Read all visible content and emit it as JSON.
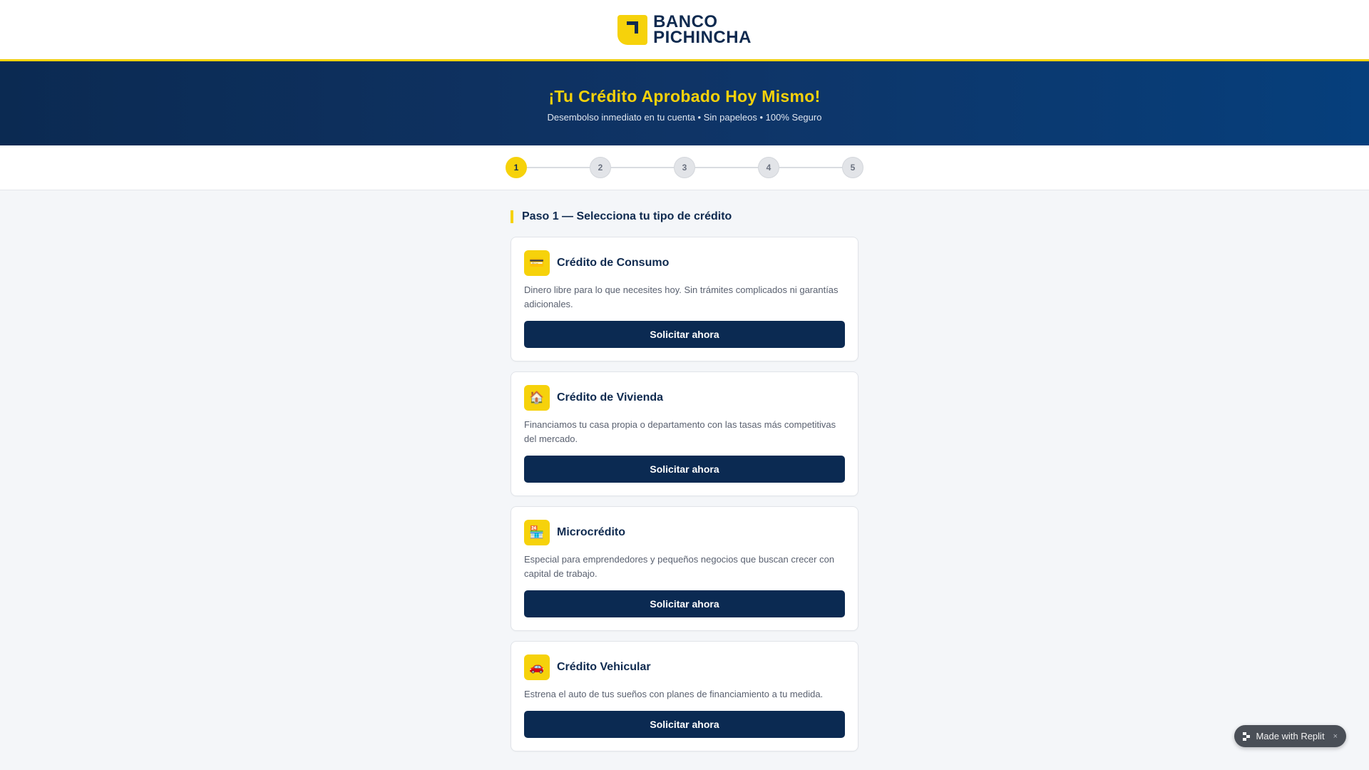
{
  "brand": {
    "line1": "BANCO",
    "line2": "PICHINCHA"
  },
  "hero": {
    "title": "¡Tu Crédito Aprobado Hoy Mismo!",
    "subtitle": "Desembolso inmediato en tu cuenta • Sin papeleos • 100% Seguro"
  },
  "stepper": {
    "steps": [
      "1",
      "2",
      "3",
      "4",
      "5"
    ],
    "current": 1
  },
  "section": {
    "title": "Paso 1 — Selecciona tu tipo de crédito"
  },
  "cards": [
    {
      "icon": "credit-card-icon",
      "glyph": "💳",
      "title": "Crédito de Consumo",
      "desc": "Dinero libre para lo que necesites hoy. Sin trámites complicados ni garantías adicionales.",
      "button": "Solicitar ahora"
    },
    {
      "icon": "house-icon",
      "glyph": "🏠",
      "title": "Crédito de Vivienda",
      "desc": "Financiamos tu casa propia o departamento con las tasas más competitivas del mercado.",
      "button": "Solicitar ahora"
    },
    {
      "icon": "store-icon",
      "glyph": "🏪",
      "title": "Microcrédito",
      "desc": "Especial para emprendedores y pequeños negocios que buscan crecer con capital de trabajo.",
      "button": "Solicitar ahora"
    },
    {
      "icon": "car-icon",
      "glyph": "🚗",
      "title": "Crédito Vehicular",
      "desc": "Estrena el auto de tus sueños con planes de financiamiento a tu medida.",
      "button": "Solicitar ahora"
    }
  ],
  "badge": {
    "label": "Made with Replit",
    "close": "×"
  },
  "colors": {
    "accent": "#f6d20b",
    "navy": "#0b2a52",
    "background": "#f4f6f9"
  }
}
